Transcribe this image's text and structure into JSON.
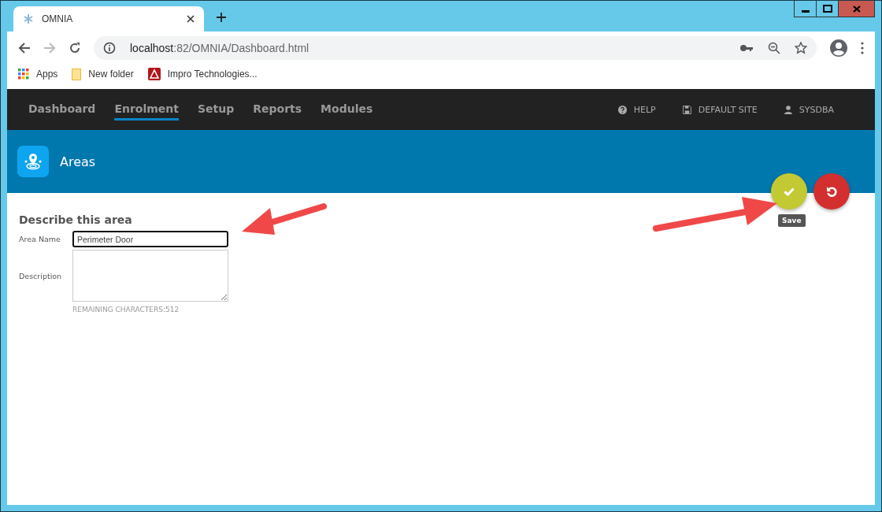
{
  "browser": {
    "tab_title": "OMNIA",
    "url_host": "localhost",
    "url_path": ":82/OMNIA/Dashboard.html",
    "bookmarks": [
      {
        "label": "Apps",
        "kind": "apps"
      },
      {
        "label": "New folder",
        "kind": "folder"
      },
      {
        "label": "Impro Technologies...",
        "kind": "site"
      }
    ]
  },
  "nav": {
    "tabs": [
      {
        "label": "Dashboard",
        "selected": false
      },
      {
        "label": "Enrolment",
        "selected": true
      },
      {
        "label": "Setup",
        "selected": false
      },
      {
        "label": "Reports",
        "selected": false
      },
      {
        "label": "Modules",
        "selected": false
      }
    ],
    "right": [
      {
        "label": "HELP",
        "kind": "help"
      },
      {
        "label": "DEFAULT SITE",
        "kind": "site"
      },
      {
        "label": "SYSDBA",
        "kind": "user"
      }
    ]
  },
  "banner": {
    "title": "Areas"
  },
  "form": {
    "heading": "Describe this area",
    "area_name_label": "Area Name",
    "area_name_value": "Perimeter Door",
    "description_label": "Description",
    "remaining": "REMAINING CHARACTERS:512"
  },
  "actions": {
    "save_tooltip": "Save"
  }
}
